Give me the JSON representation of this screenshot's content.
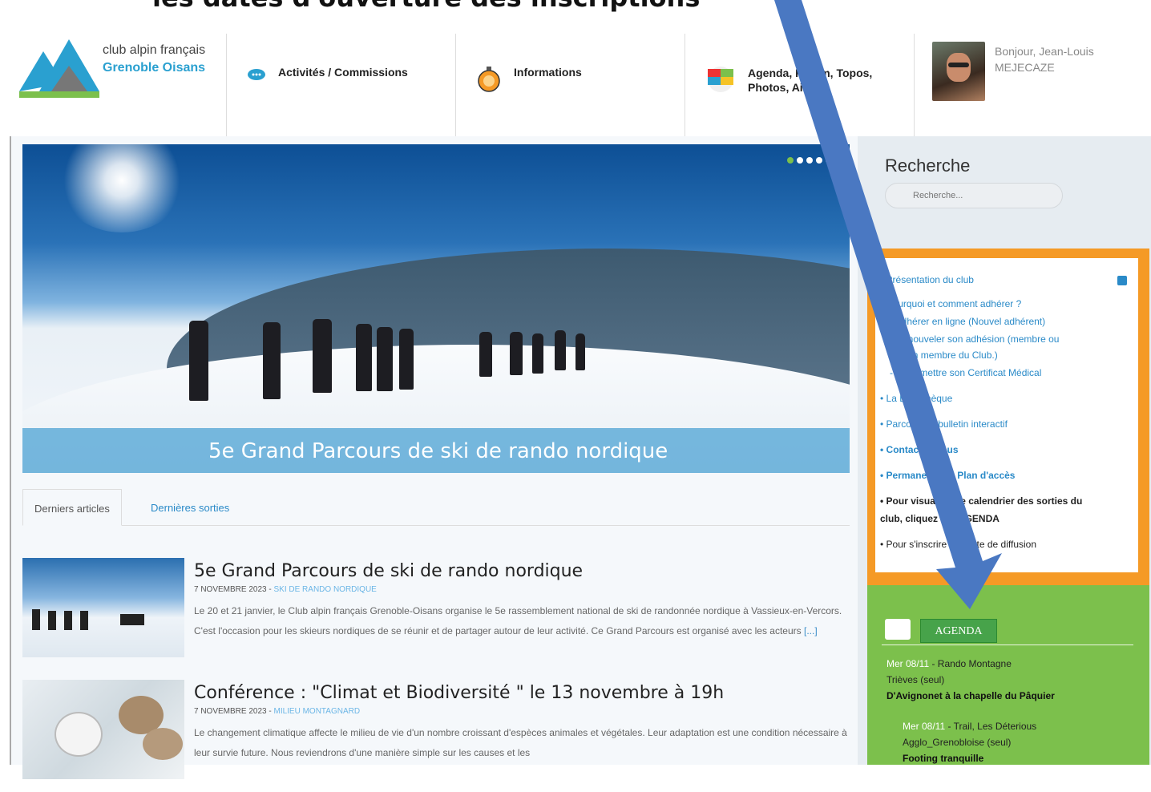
{
  "caption": "les dates d'ouverture des inscriptions",
  "logo": {
    "line1": "club alpin français",
    "line2": "Grenoble Oisans"
  },
  "nav": {
    "items": [
      {
        "label": "Activités / Commissions",
        "icon": "speech-bubble-icon"
      },
      {
        "label": "Informations",
        "icon": "compass-icon"
      },
      {
        "label": "Agenda, Forum, Topos, Photos, Aide",
        "icon": "color-squares-icon"
      }
    ],
    "user": {
      "greeting": "Bonjour, Jean-Louis",
      "lastname": "MEJECAZE"
    }
  },
  "hero": {
    "caption": "5e Grand Parcours de ski de rando nordique",
    "slides": 5,
    "active_slide": 1
  },
  "tabs": [
    "Derniers articles",
    "Dernières sorties"
  ],
  "articles": [
    {
      "title": "5e Grand Parcours de ski de rando nordique",
      "date": "7 NOVEMBRE 2023 - ",
      "category": "SKI DE RANDO NORDIQUE",
      "text": "Le 20 et 21 janvier, le Club alpin français Grenoble-Oisans organise le 5e rassemblement national de ski de randonnée nordique à Vassieux-en-Vercors. C'est l'occasion pour les skieurs nordiques de se réunir et de partager autour de leur activité. Ce Grand Parcours est organisé avec les acteurs",
      "more": "[...]"
    },
    {
      "title": "Conférence : \"Climat et Biodiversité \" le 13 novembre à 19h",
      "date": "7 NOVEMBRE 2023 - ",
      "category": "MILIEU MONTAGNARD",
      "text": "Le changement climatique affecte le milieu de vie d'un nombre croissant d'espèces animales et végétales. Leur adaptation est une condition nécessaire à leur survie future. Nous reviendrons d'une manière simple sur les causes et les",
      "more": ""
    }
  ],
  "sidebar": {
    "search_title": "Recherche",
    "search_placeholder": "Recherche...",
    "links": [
      "• Présentation du club",
      "• Pourquoi et comment adhérer ?",
      "- Adhérer en ligne (Nouvel adhérent)",
      "- Renouveler son adhésion (membre ou",
      "ancien membre du Club.)",
      "- Transmettre son Certificat Médical",
      "• La Bibliothèque",
      "• Parcourir le bulletin interactif",
      "• Contactez-nous",
      "• Permanences - Plan d'accès",
      "• Pour visualiser le calendrier des sorties du",
      "club, cliquez sur AGENDA",
      "• Pour s'inscrire à la liste de diffusion"
    ],
    "agenda_button": "AGENDA",
    "events": [
      {
        "date": "Mer 08/11",
        "title": " - Rando Montagne",
        "line2": "Trièves (seul)",
        "line3": "D'Avignonet à la chapelle du Pâquier"
      },
      {
        "date": "Mer 08/11",
        "title": " - Trail, Les Déterious",
        "line2": "Agglo_Grenobloise (seul)",
        "line3": "Footing tranquille"
      }
    ]
  },
  "colors": {
    "orange": "#f59a26",
    "green": "#7cc04c",
    "link": "#2a8ac8",
    "arrow": "#4a78c2"
  }
}
